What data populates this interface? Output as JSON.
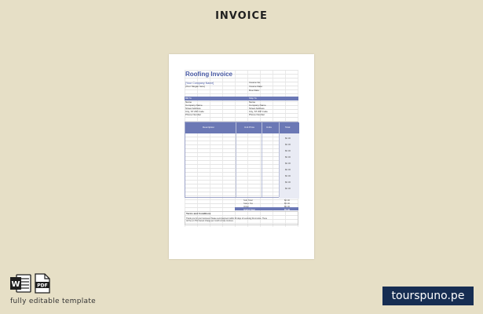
{
  "header": {
    "title": "INVOICE"
  },
  "document": {
    "title": "Roofing Invoice",
    "company_name": "[Your Company Name]",
    "company_slogan": "[Your Slogan here]",
    "invoice_no": "Invoice No:",
    "invoice_date": "Invoice Date:",
    "due_date": "Due Date:",
    "bill_to": "Bill To",
    "ship_to": "Ship To",
    "bill_lines": [
      "Name",
      "Company Name",
      "Street Address",
      "City, ST ZIP Code",
      "Phone Number"
    ],
    "ship_lines": [
      "Name",
      "Company Name",
      "Street Address",
      "City, ST ZIP Code",
      "Phone Number"
    ],
    "col_description": "Description",
    "col_unit_price": "Unit Price",
    "col_units": "Units",
    "col_total": "Total",
    "row_totals": [
      "$0.00",
      "$0.00",
      "$0.00",
      "$0.00",
      "$0.00",
      "$0.00",
      "$0.00",
      "$0.00",
      "$0.00"
    ],
    "sub_total_label": "Sub Total",
    "sub_total_value": "$0.00",
    "sales_tax_label": "Sales Tax",
    "sales_tax_value": "$0.00",
    "other_label": "Other",
    "other_value": "$0.00",
    "grand_total_label": "Grand Total",
    "grand_total_value": "$0.00",
    "terms_title": "Terms and Conditions",
    "terms_text_1": "Thank you for your business. Please send payment within 30 days of receiving this invoice. There",
    "terms_text_2": "will be a 1.5% interest charge per month on late invoices."
  },
  "footer": {
    "caption": "fully editable template",
    "brand": "tourspuno.pe",
    "word_icon_letter": "W",
    "pdf_icon_label": "PDF"
  },
  "colors": {
    "background": "#e6dfc6",
    "accent": "#6b78b5",
    "brand_bg": "#162d52"
  }
}
